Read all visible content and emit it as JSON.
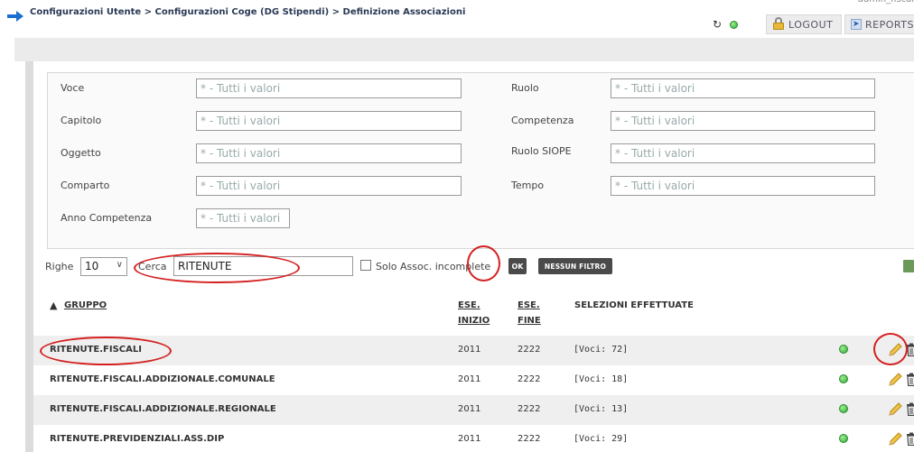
{
  "header": {
    "breadcrumb": "Configurazioni Utente > Configurazioni Coge (DG Stipendi) > Definizione Associazioni",
    "user_fragment": "admin_fiscal",
    "logout_label": "LOGOUT",
    "reports_label": "REPORTS"
  },
  "filters": {
    "voce": {
      "label": "Voce",
      "placeholder": "* - Tutti i valori"
    },
    "capitolo": {
      "label": "Capitolo",
      "placeholder": "* - Tutti i valori"
    },
    "oggetto": {
      "label": "Oggetto",
      "placeholder": "* - Tutti i valori"
    },
    "comparto": {
      "label": "Comparto",
      "placeholder": "* - Tutti i valori"
    },
    "anno_competenza": {
      "label": "Anno Competenza",
      "placeholder": "* - Tutti i valori"
    },
    "ruolo": {
      "label": "Ruolo",
      "placeholder": "* - Tutti i valori"
    },
    "competenza": {
      "label": "Competenza",
      "placeholder": "* - Tutti i valori"
    },
    "ruolo_siope": {
      "label": "Ruolo SIOPE",
      "placeholder": "* - Tutti i valori"
    },
    "tempo": {
      "label": "Tempo",
      "placeholder": "* - Tutti i valori"
    }
  },
  "toolbar": {
    "righe_label": "Righe",
    "righe_value": "10",
    "cerca_label": "Cerca",
    "cerca_value": "RITENUTE",
    "solo_label": "Solo Assoc. incomplete",
    "ok_label": "OK",
    "nessun_filtro_label": "NESSUN FILTRO"
  },
  "table": {
    "headers": {
      "gruppo": "GRUPPO",
      "ese_inizio_1": "ESE.",
      "ese_inizio_2": "INIZIO",
      "ese_fine_1": "ESE.",
      "ese_fine_2": "FINE",
      "selezioni": "SELEZIONI EFFETTUATE"
    },
    "sort_arrow": "▲",
    "rows": [
      {
        "gruppo": "RITENUTE.FISCALI",
        "inizio": "2011",
        "fine": "2222",
        "selezioni": "[Voci: 72]"
      },
      {
        "gruppo": "RITENUTE.FISCALI.ADDIZIONALE.COMUNALE",
        "inizio": "2011",
        "fine": "2222",
        "selezioni": "[Voci: 18]"
      },
      {
        "gruppo": "RITENUTE.FISCALI.ADDIZIONALE.REGIONALE",
        "inizio": "2011",
        "fine": "2222",
        "selezioni": "[Voci: 13]"
      },
      {
        "gruppo": "RITENUTE.PREVIDENZIALI.ASS.DIP",
        "inizio": "2011",
        "fine": "2222",
        "selezioni": "[Voci: 29]"
      }
    ]
  },
  "colors": {
    "annotation": "#d42020",
    "status_green": "#2fa83a",
    "button_dark": "#4a4a4a"
  }
}
